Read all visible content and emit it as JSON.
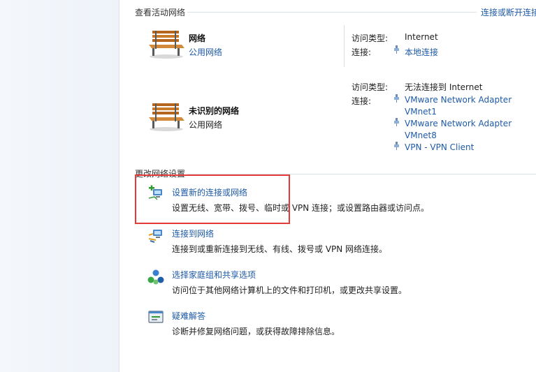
{
  "active_networks": {
    "header": "查看活动网络",
    "connect_disconnect_link": "连接或断开连接",
    "networks": [
      {
        "name": "网络",
        "type": "公用网络",
        "access_type_label": "访问类型:",
        "access_type_value": "Internet",
        "connections_label": "连接:",
        "connections": [
          "本地连接"
        ]
      },
      {
        "name": "未识别的网络",
        "type": "公用网络",
        "access_type_label": "访问类型:",
        "access_type_value": "无法连接到 Internet",
        "connections_label": "连接:",
        "connections": [
          [
            "VMware Network Adapter",
            "VMnet1"
          ],
          [
            "VMware Network Adapter",
            "VMnet8"
          ],
          [
            "VPN - VPN Client"
          ]
        ]
      }
    ]
  },
  "change_settings": {
    "header": "更改网络设置",
    "tasks": [
      {
        "title": "设置新的连接或网络",
        "desc": "设置无线、宽带、拨号、临时或 VPN 连接；或设置路由器或访问点。",
        "icon": "new-connection-icon"
      },
      {
        "title": "连接到网络",
        "desc": "连接到或重新连接到无线、有线、拨号或 VPN 网络连接。",
        "icon": "connect-network-icon"
      },
      {
        "title": "选择家庭组和共享选项",
        "desc": "访问位于其他网络计算机上的文件和打印机，或更改共享设置。",
        "icon": "homegroup-icon"
      },
      {
        "title": "疑难解答",
        "desc": "诊断并修复网络问题，或获得故障排除信息。",
        "icon": "troubleshoot-icon"
      }
    ]
  },
  "colors": {
    "link": "#1e5aa8",
    "highlight_box": "#e53a3a"
  }
}
